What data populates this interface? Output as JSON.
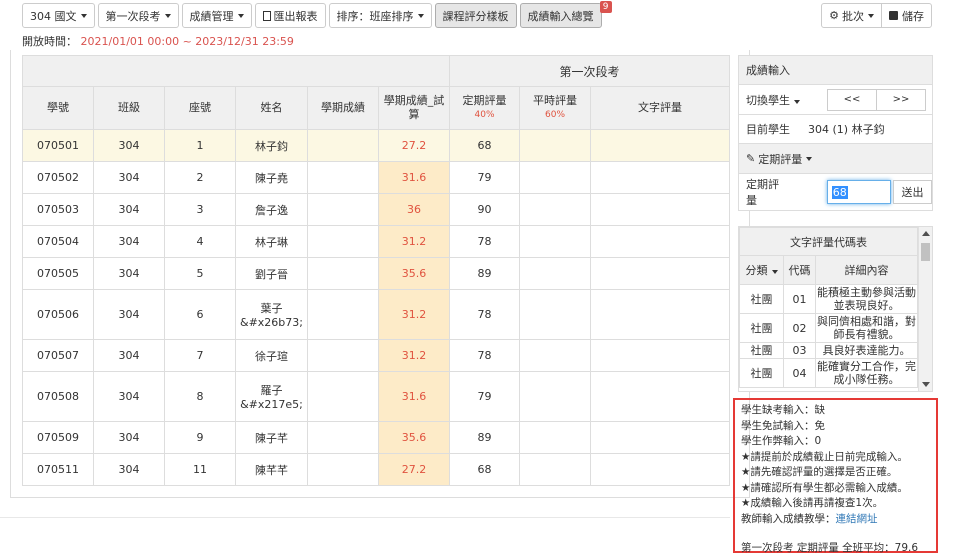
{
  "toolbar": {
    "class_dropdown": "304 國文",
    "exam_dropdown": "第一次段考",
    "grade_mgmt": "成績管理",
    "export_icon": "file-icon",
    "export": "匯出報表",
    "sort": "排序：班座排序",
    "course_template": "課程評分樣板",
    "overview": "成績輸入總覽",
    "overview_badge": "9",
    "batch_icon": "gear-icon",
    "batch": "批次",
    "save_icon": "save-icon",
    "save": "儲存"
  },
  "open_time": {
    "label": "開放時間：",
    "value": "2021/01/01 00:00 ~ 2023/12/31 23:59"
  },
  "table": {
    "group_header": "第一次段考",
    "columns": {
      "student_id": "學號",
      "class": "班級",
      "seat": "座號",
      "name": "姓名",
      "term_score": "學期成績",
      "term_score_trial": "學期成績_試算",
      "final_eval": "定期評量",
      "final_pct": "40%",
      "regular_eval": "平時評量",
      "regular_pct": "60%",
      "text_eval": "文字評量"
    },
    "rows": [
      {
        "id": "070501",
        "class": "304",
        "seat": "1",
        "name": "林子鈞",
        "term": "",
        "trial": "27.2",
        "final": "68",
        "regular": "",
        "text": ""
      },
      {
        "id": "070502",
        "class": "304",
        "seat": "2",
        "name": "陳子堯",
        "term": "",
        "trial": "31.6",
        "final": "79",
        "regular": "",
        "text": ""
      },
      {
        "id": "070503",
        "class": "304",
        "seat": "3",
        "name": "詹子逸",
        "term": "",
        "trial": "36",
        "final": "90",
        "regular": "",
        "text": ""
      },
      {
        "id": "070504",
        "class": "304",
        "seat": "4",
        "name": "林子琳",
        "term": "",
        "trial": "31.2",
        "final": "78",
        "regular": "",
        "text": ""
      },
      {
        "id": "070505",
        "class": "304",
        "seat": "5",
        "name": "劉子晉",
        "term": "",
        "trial": "35.6",
        "final": "89",
        "regular": "",
        "text": ""
      },
      {
        "id": "070506",
        "class": "304",
        "seat": "6",
        "name_l1": "葉子",
        "name_l2": "&#x26b73;",
        "term": "",
        "trial": "31.2",
        "final": "78",
        "regular": "",
        "text": ""
      },
      {
        "id": "070507",
        "class": "304",
        "seat": "7",
        "name": "徐子瑄",
        "term": "",
        "trial": "31.2",
        "final": "78",
        "regular": "",
        "text": ""
      },
      {
        "id": "070508",
        "class": "304",
        "seat": "8",
        "name_l1": "羅子",
        "name_l2": "&#x217e5;",
        "term": "",
        "trial": "31.6",
        "final": "79",
        "regular": "",
        "text": ""
      },
      {
        "id": "070509",
        "class": "304",
        "seat": "9",
        "name": "陳子芊",
        "term": "",
        "trial": "35.6",
        "final": "89",
        "regular": "",
        "text": ""
      },
      {
        "id": "070511",
        "class": "304",
        "seat": "11",
        "name": "陳芊芊",
        "term": "",
        "trial": "27.2",
        "final": "68",
        "regular": "",
        "text": ""
      }
    ]
  },
  "score_panel": {
    "title": "成績輸入",
    "switch_student": "切換學生",
    "prev": "<<",
    "next": ">>",
    "current_label": "目前學生",
    "current_value": "304 (1) 林子鈞",
    "eval_icon": "edit-icon",
    "eval_dropdown": "定期評量",
    "field_label": "定期評量",
    "field_value": "68",
    "send": "送出"
  },
  "code_table": {
    "title": "文字評量代碼表",
    "col_category": "分類",
    "col_code": "代碼",
    "col_detail": "詳細內容",
    "rows": [
      {
        "category": "社團",
        "code": "01",
        "detail": "能積極主動參與活動並表現良好。"
      },
      {
        "category": "社團",
        "code": "02",
        "detail": "與同儕相處和諧，對師長有禮貌。"
      },
      {
        "category": "社團",
        "code": "03",
        "detail": "具良好表達能力。"
      },
      {
        "category": "社團",
        "code": "04",
        "detail": "能確實分工合作，完成小隊任務。"
      }
    ]
  },
  "notes": {
    "absent": "學生缺考輸入：缺",
    "exempt": "學生免試輸入：免",
    "cheat": "學生作弊輸入：0",
    "tip1": "★請提前於成績截止日前完成輸入。",
    "tip2": "★請先確認評量的選擇是否正確。",
    "tip3": "★請確認所有學生都必需輸入成績。",
    "tip4": "★成績輸入後請再請複查1次。",
    "tutorial_label": "教師輸入成績教學：",
    "tutorial_link": "連結網址",
    "average": "第一次段考 定期評量 全班平均：79.6"
  }
}
